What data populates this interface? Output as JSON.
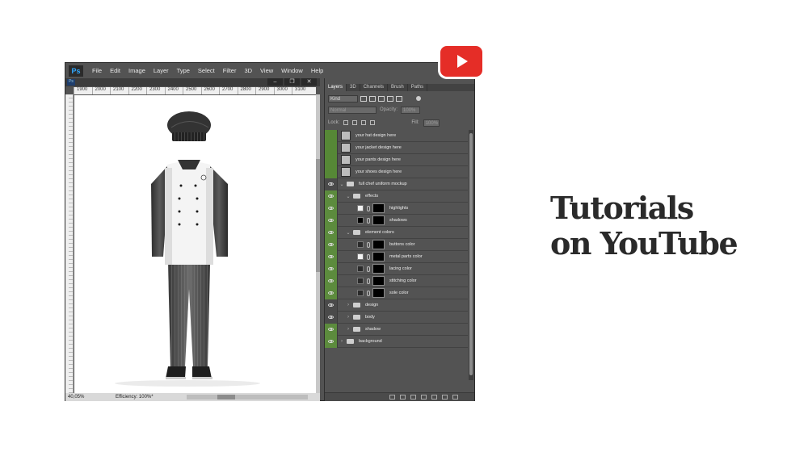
{
  "app": {
    "logo": "Ps"
  },
  "menubar": {
    "items": [
      "File",
      "Edit",
      "Image",
      "Layer",
      "Type",
      "Select",
      "Filter",
      "3D",
      "View",
      "Window",
      "Help"
    ]
  },
  "document": {
    "ruler_ticks": [
      "1900",
      "2000",
      "2100",
      "2200",
      "2300",
      "2400",
      "2500",
      "2600",
      "2700",
      "2800",
      "2900",
      "3000",
      "3100"
    ],
    "zoom": "40,05%",
    "efficiency": "Efficiency: 100%*"
  },
  "layers_panel": {
    "tabs": [
      "Layers",
      "3D",
      "Channels",
      "Brush",
      "Paths"
    ],
    "active_tab": "Layers",
    "filter_kind": "Kind",
    "blend_mode": "Normal",
    "opacity_label": "Opacity:",
    "opacity_value": "100%",
    "lock_label": "Lock:",
    "fill_label": "Fill:",
    "fill_value": "100%",
    "layers": [
      {
        "name": "your hat design here",
        "type": "smart",
        "vis": "green"
      },
      {
        "name": "your jacket design here",
        "type": "smart",
        "vis": "green"
      },
      {
        "name": "your pants design here",
        "type": "smart",
        "vis": "green"
      },
      {
        "name": "your shoes design here",
        "type": "smart",
        "vis": "green"
      },
      {
        "name": "full chef uniform mockup",
        "type": "group",
        "vis": "eye"
      },
      {
        "name": "effects",
        "type": "subgroup",
        "vis": "eye-green"
      },
      {
        "name": "highlights",
        "type": "fill-white",
        "vis": "eye-green"
      },
      {
        "name": "shadows",
        "type": "fill-black",
        "vis": "eye-green"
      },
      {
        "name": "element colors",
        "type": "subgroup",
        "vis": "eye-green"
      },
      {
        "name": "buttons color",
        "type": "fill-dark",
        "vis": "eye-green"
      },
      {
        "name": "metal parts color",
        "type": "fill-white",
        "vis": "eye-green"
      },
      {
        "name": "lacing color",
        "type": "fill-dark",
        "vis": "eye-green"
      },
      {
        "name": "stitching color",
        "type": "fill-dark",
        "vis": "eye-green"
      },
      {
        "name": "sole color",
        "type": "fill-dark",
        "vis": "eye-green"
      },
      {
        "name": "design",
        "type": "subgroup",
        "vis": "eye"
      },
      {
        "name": "body",
        "type": "subgroup",
        "vis": "eye"
      },
      {
        "name": "shadow",
        "type": "subgroup",
        "vis": "eye-green"
      },
      {
        "name": "background",
        "type": "group",
        "vis": "eye-green"
      }
    ]
  },
  "headline": {
    "line1": "Tutorials",
    "line2": "on YouTube"
  },
  "icons": {
    "youtube": "youtube-play-icon"
  },
  "colors": {
    "youtube_red": "#e52d27",
    "ps_bg": "#535353",
    "layer_green": "#5c8b3d"
  }
}
